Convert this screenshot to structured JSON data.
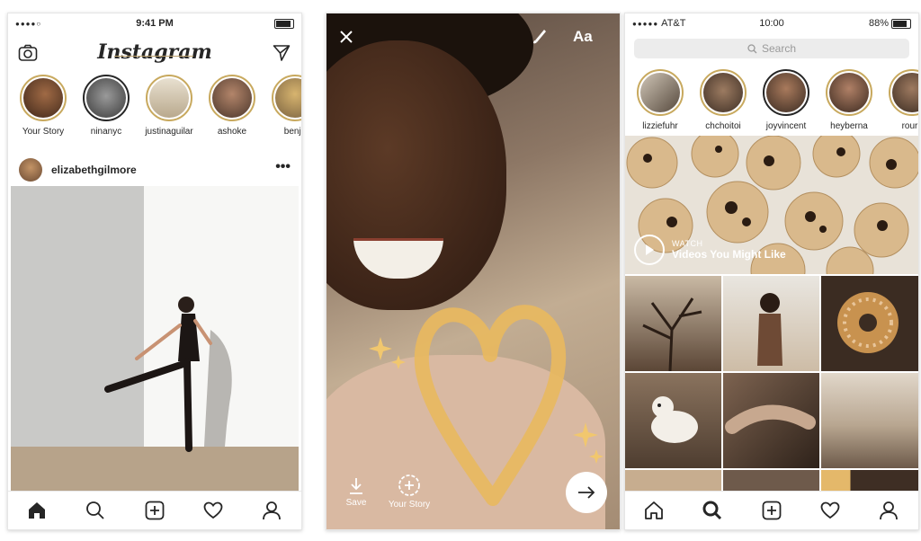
{
  "phone1": {
    "status": {
      "time": "9:41 PM"
    },
    "header": {
      "logo": "Instagram"
    },
    "stories": [
      {
        "label": "Your Story"
      },
      {
        "label": "ninanyc"
      },
      {
        "label": "justinaguilar"
      },
      {
        "label": "ashoke"
      },
      {
        "label": "benjir"
      }
    ],
    "post": {
      "username": "elizabethgilmore",
      "more": "•••"
    }
  },
  "phone2": {
    "text_tool": "Aa",
    "save_label": "Save",
    "your_story_label": "Your Story"
  },
  "phone3": {
    "status": {
      "carrier": "AT&T",
      "time": "10:00",
      "battery": "88%"
    },
    "search": {
      "placeholder": "Search"
    },
    "stories": [
      {
        "label": "lizziefuhr"
      },
      {
        "label": "chchoitoi"
      },
      {
        "label": "joyvincent"
      },
      {
        "label": "heyberna"
      },
      {
        "label": "rourk"
      }
    ],
    "watch": {
      "kicker": "WATCH",
      "title": "Videos You Might Like"
    }
  },
  "colors": {
    "accent": "#c8a95e",
    "heart": "#e8b860",
    "nav_icon": "#262626"
  }
}
